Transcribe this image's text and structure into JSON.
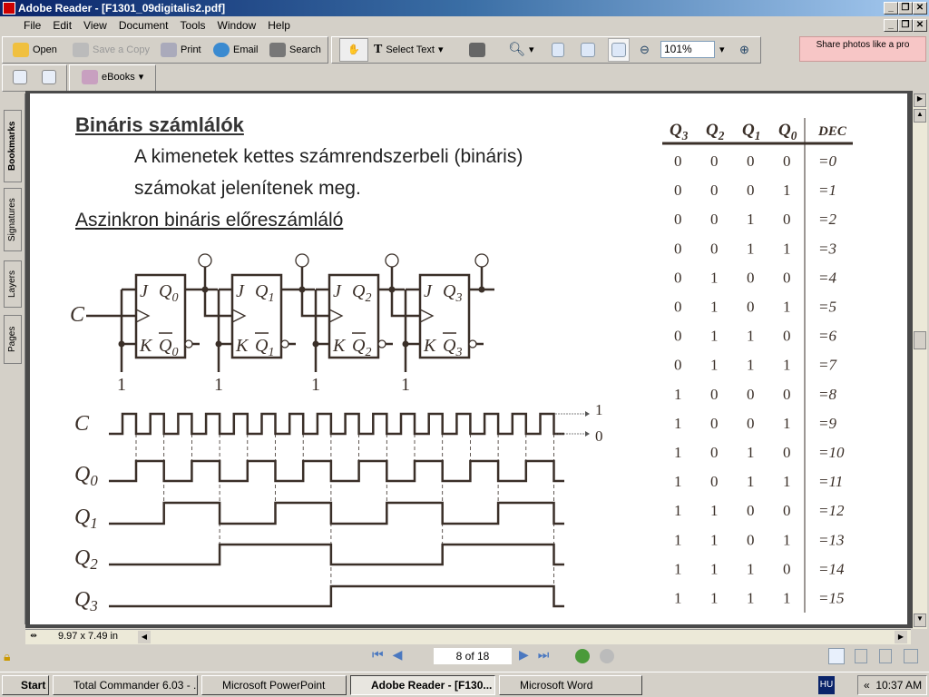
{
  "window": {
    "title": "Adobe Reader - [F1301_09digitalis2.pdf]"
  },
  "menu": [
    "File",
    "Edit",
    "View",
    "Document",
    "Tools",
    "Window",
    "Help"
  ],
  "toolbar": {
    "open": "Open",
    "save_copy": "Save a Copy",
    "print": "Print",
    "email": "Email",
    "search": "Search",
    "select_text": "Select Text",
    "zoom": "101%",
    "ebooks": "eBooks",
    "ad": "Share photos like a pro"
  },
  "side_tabs": [
    "Bookmarks",
    "Signatures",
    "Layers",
    "Pages"
  ],
  "doc": {
    "heading": "Bináris számlálók",
    "line1": "A kimenetek kettes számrendszerbeli (bináris)",
    "line2": "számokat jelenítenek meg.",
    "subheading": "Aszinkron bináris előreszámláló",
    "clock_label": "C",
    "stages": [
      {
        "q": "Q",
        "n": "0",
        "one": "1"
      },
      {
        "q": "Q",
        "n": "1",
        "one": "1"
      },
      {
        "q": "Q",
        "n": "2",
        "one": "1"
      },
      {
        "q": "Q",
        "n": "3",
        "one": "1"
      }
    ],
    "jk": {
      "j": "J",
      "k": "K"
    },
    "timing": {
      "signals": [
        {
          "base": "C",
          "sub": ""
        },
        {
          "base": "Q",
          "sub": "0"
        },
        {
          "base": "Q",
          "sub": "1"
        },
        {
          "base": "Q",
          "sub": "2"
        },
        {
          "base": "Q",
          "sub": "3"
        }
      ],
      "level_high": "1",
      "level_low": "0",
      "clock_pulses": 16
    },
    "table": {
      "headers": [
        {
          "b": "Q",
          "s": "3"
        },
        {
          "b": "Q",
          "s": "2"
        },
        {
          "b": "Q",
          "s": "1"
        },
        {
          "b": "Q",
          "s": "0"
        },
        {
          "b": "DEC",
          "s": ""
        }
      ],
      "rows": [
        [
          "0",
          "0",
          "0",
          "0",
          "=0"
        ],
        [
          "0",
          "0",
          "0",
          "1",
          "=1"
        ],
        [
          "0",
          "0",
          "1",
          "0",
          "=2"
        ],
        [
          "0",
          "0",
          "1",
          "1",
          "=3"
        ],
        [
          "0",
          "1",
          "0",
          "0",
          "=4"
        ],
        [
          "0",
          "1",
          "0",
          "1",
          "=5"
        ],
        [
          "0",
          "1",
          "1",
          "0",
          "=6"
        ],
        [
          "0",
          "1",
          "1",
          "1",
          "=7"
        ],
        [
          "1",
          "0",
          "0",
          "0",
          "=8"
        ],
        [
          "1",
          "0",
          "0",
          "1",
          "=9"
        ],
        [
          "1",
          "0",
          "1",
          "0",
          "=10"
        ],
        [
          "1",
          "0",
          "1",
          "1",
          "=11"
        ],
        [
          "1",
          "1",
          "0",
          "0",
          "=12"
        ],
        [
          "1",
          "1",
          "0",
          "1",
          "=13"
        ],
        [
          "1",
          "1",
          "1",
          "0",
          "=14"
        ],
        [
          "1",
          "1",
          "1",
          "1",
          "=15"
        ]
      ]
    }
  },
  "status": {
    "page_size": "9.97 x 7.49 in",
    "page": "8 of 18"
  },
  "taskbar": {
    "start": "Start",
    "tasks": [
      "Total Commander 6.03 - ...",
      "Microsoft PowerPoint",
      "Adobe Reader - [F130...",
      "Microsoft Word"
    ],
    "lang": "HU",
    "clock": "10:37 AM"
  }
}
